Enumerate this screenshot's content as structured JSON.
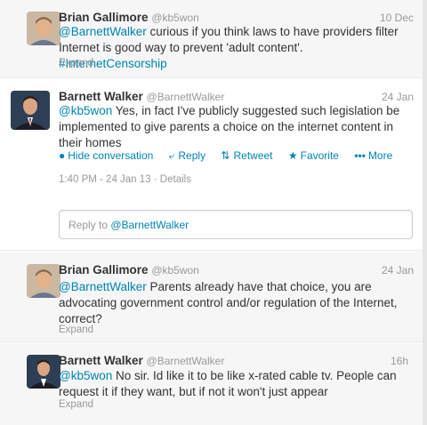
{
  "tweets": [
    {
      "fullname": "Brian Gallimore",
      "screen": "@kb5won",
      "time": "10 Dec",
      "mention": "@BarnettWalker",
      "body1": " curious if you think laws to have providers filter Internet is good way to prevent 'adult content'. ",
      "hashtag": "#InternetCensorship",
      "expand": "Expand"
    },
    {
      "fullname": "Barnett Walker",
      "screen": "@BarnettWalker",
      "time": "24 Jan",
      "mention": "@kb5won",
      "body1": " Yes, in fact I've publicly suggested such legislation be implemented to give parents a choice on the internet content in their homes",
      "actions": {
        "hide": "Hide conversation",
        "reply": "Reply",
        "retweet": "Retweet",
        "favorite": "Favorite",
        "more": "More"
      },
      "meta_time": "1:40 PM - 24 Jan 13",
      "meta_sep": " · ",
      "meta_details": "Details"
    },
    {
      "fullname": "Brian Gallimore",
      "screen": "@kb5won",
      "time": "24 Jan",
      "mention": "@BarnettWalker",
      "body1": " Parents already have that choice, you are advocating government control and/or regulation of the Internet, correct?",
      "expand": "Expand"
    },
    {
      "fullname": "Barnett Walker",
      "screen": "@BarnettWalker",
      "time": "16h",
      "mention": "@kb5won",
      "body1": " No sir. Id like it to be like x-rated cable tv. People can request it if they want, but if not it won't just appear",
      "expand": "Expand"
    }
  ],
  "reply_box": {
    "prefix": "Reply to ",
    "mention": "@BarnettWalker"
  },
  "colors": {
    "link": "#0084b4",
    "muted": "#999999",
    "text": "#333333",
    "sub_background": "#f6f6f6"
  }
}
